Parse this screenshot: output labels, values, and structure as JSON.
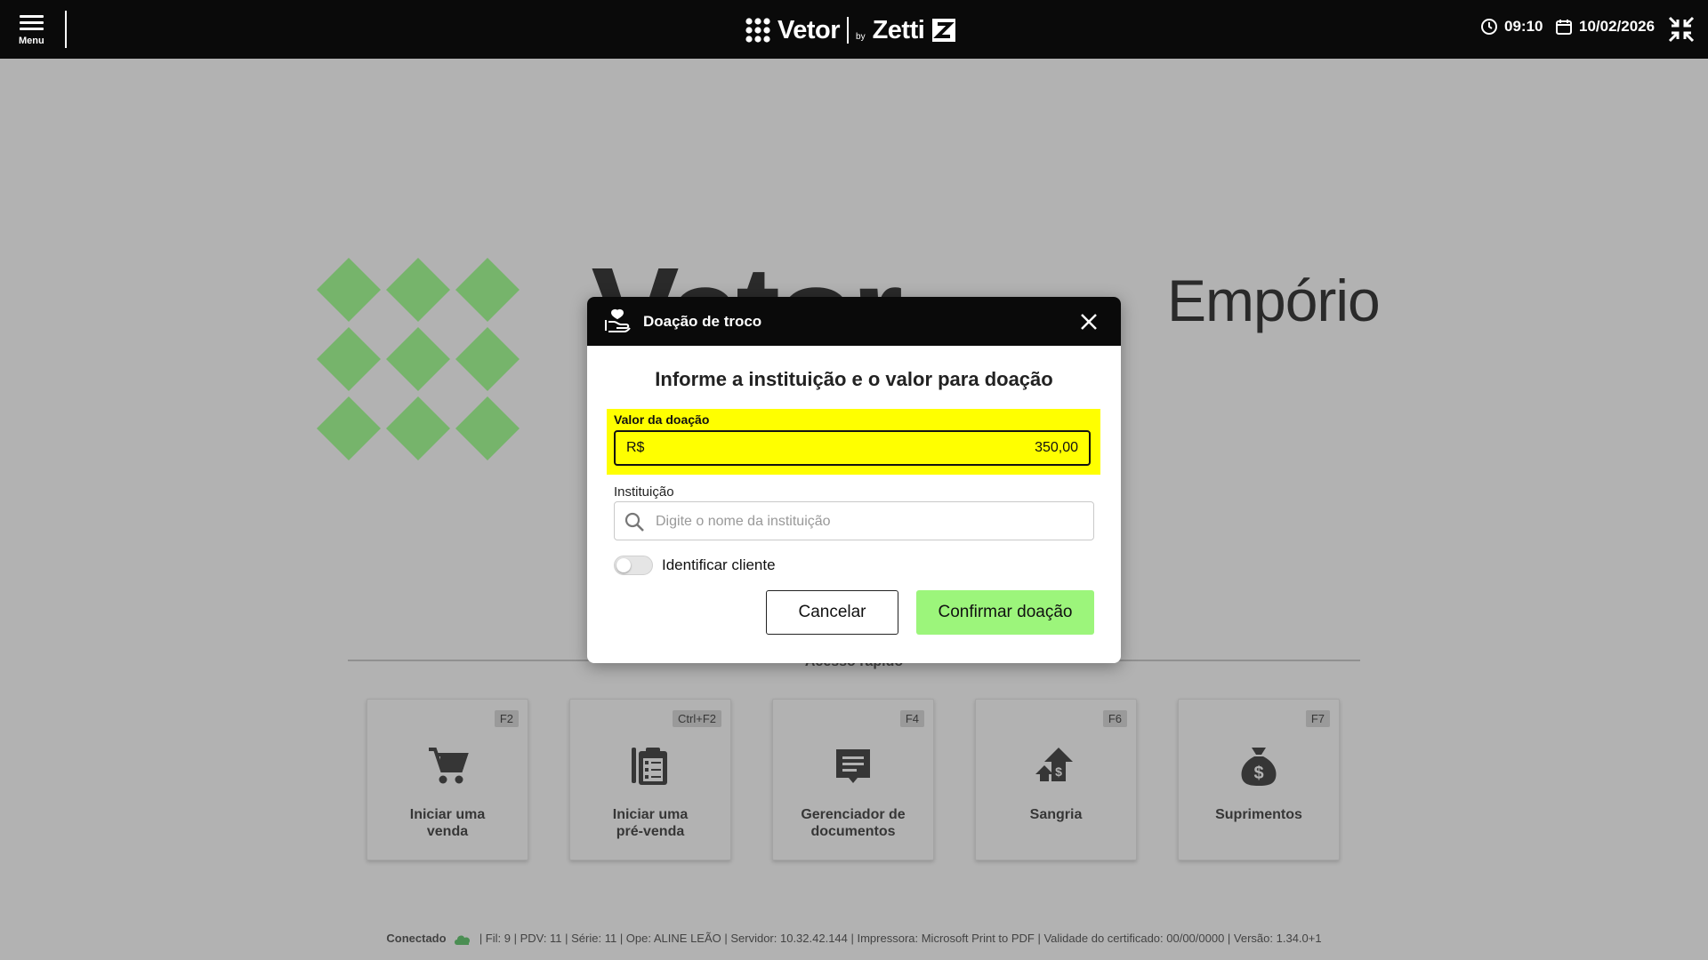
{
  "topbar": {
    "menu_label": "Menu",
    "brand_left": "Vetor",
    "brand_by": "by",
    "brand_right": "Zetti",
    "time": "09:10",
    "date": "10/02/2026"
  },
  "background": {
    "brand_name": "Vetor",
    "store_name": "Empório",
    "logo_color": "#6abf5a"
  },
  "quick_access": {
    "title": "Acesso rápido",
    "cards": [
      {
        "key": "F2",
        "line1": "Iniciar uma",
        "line2": "venda",
        "icon": "cart-icon"
      },
      {
        "key": "Ctrl+F2",
        "line1": "Iniciar uma",
        "line2": "pré-venda",
        "icon": "clipboard-cart-icon"
      },
      {
        "key": "F4",
        "line1": "Gerenciador de",
        "line2": "documentos",
        "icon": "document-chat-icon"
      },
      {
        "key": "F6",
        "line1": "Sangria",
        "line2": "",
        "icon": "money-out-icon"
      },
      {
        "key": "F7",
        "line1": "Suprimentos",
        "line2": "",
        "icon": "money-bag-icon"
      }
    ]
  },
  "status": {
    "connected": "Conectado",
    "details": "| Fil: 9 | PDV: 11 | Série: 11 | Ope: ALINE LEÃO | Servidor: 10.32.42.144 | Impressora: Microsoft Print to PDF | Validade do certificado: 00/00/0000 | Versão: 1.34.0+1"
  },
  "modal": {
    "title": "Doação de troco",
    "subtitle": "Informe a instituição e o valor para doação",
    "amount_label": "Valor da doação",
    "currency": "R$",
    "amount": "350,00",
    "institution_label": "Instituição",
    "institution_placeholder": "Digite o nome da instituição",
    "institution_value": "",
    "toggle_label": "Identificar cliente",
    "cancel_label": "Cancelar",
    "confirm_label": "Confirmar doação",
    "highlight_color": "#ffff00",
    "confirm_color": "#9cf57b"
  }
}
